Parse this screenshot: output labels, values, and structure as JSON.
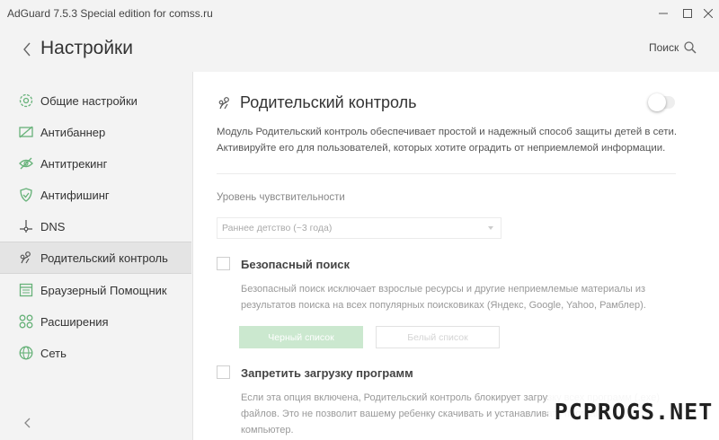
{
  "window": {
    "title": "AdGuard 7.5.3  Special edition for comss.ru"
  },
  "header": {
    "title": "Настройки",
    "search_label": "Поиск"
  },
  "sidebar": {
    "items": [
      {
        "label": "Общие настройки",
        "icon": "gear-icon"
      },
      {
        "label": "Антибаннер",
        "icon": "antibanner-icon"
      },
      {
        "label": "Антитрекинг",
        "icon": "eye-slash-icon"
      },
      {
        "label": "Антифишинг",
        "icon": "shield-check-icon"
      },
      {
        "label": "DNS",
        "icon": "dns-icon"
      },
      {
        "label": "Родительский контроль",
        "icon": "parental-icon",
        "active": true
      },
      {
        "label": "Браузерный Помощник",
        "icon": "browser-icon"
      },
      {
        "label": "Расширения",
        "icon": "extensions-icon"
      },
      {
        "label": "Сеть",
        "icon": "globe-icon"
      }
    ]
  },
  "main": {
    "title": "Родительский контроль",
    "enabled": false,
    "description_line1": "Модуль Родительский контроль обеспечивает простой и надежный способ защиты детей в сети.",
    "description_line2": "Активируйте его для пользователей, которых хотите оградить от неприемлемой информации.",
    "sensitivity_label": "Уровень чувствительности",
    "sensitivity_value": "Раннее детство (~3 года)",
    "safe_search": {
      "title": "Безопасный поиск",
      "desc_line1": "Безопасный поиск исключает взрослые ресурсы и другие неприемлемые материалы из",
      "desc_line2": "результатов поиска на всех популярных поисковиках (Яндекс, Google, Yahoo, Рамблер).",
      "checked": false
    },
    "blacklist_button": "Черный список",
    "whitelist_button": "Белый список",
    "block_downloads": {
      "title": "Запретить загрузку программ",
      "desc_line1": "Если эта опция включена, Родительский контроль блокирует загрузку всех программ (.exe)",
      "desc_line2": "файлов. Это не позволит вашему ребенку скачивать и устанавливать программы на",
      "desc_line3": "компьютер.",
      "checked": false
    }
  },
  "watermark": "PCPROGS.NET",
  "colors": {
    "accent": "#67b279",
    "button_disabled": "#cbe8cf",
    "sidebar_bg": "#f3f3f3"
  }
}
